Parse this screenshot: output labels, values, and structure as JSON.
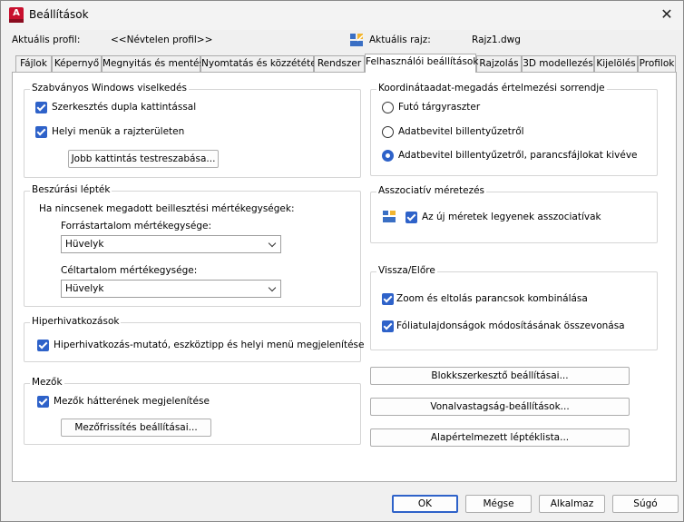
{
  "window": {
    "title": "Beállítások",
    "close_glyph": "✕",
    "app_icon_letter": "A"
  },
  "header": {
    "profile_label": "Aktuális profil:",
    "profile_value": "<<Névtelen profil>>",
    "drawing_label": "Aktuális rajz:",
    "drawing_value": "Rajz1.dwg"
  },
  "tabs": [
    {
      "label": "Fájlok"
    },
    {
      "label": "Képernyő"
    },
    {
      "label": "Megnyitás és mentés"
    },
    {
      "label": "Nyomtatás és közzététel"
    },
    {
      "label": "Rendszer"
    },
    {
      "label": "Felhasználói beállítások"
    },
    {
      "label": "Rajzolás"
    },
    {
      "label": "3D modellezés"
    },
    {
      "label": "Kijelölés"
    },
    {
      "label": "Profilok"
    }
  ],
  "windows_behavior": {
    "title": "Szabványos Windows viselkedés",
    "dblclick_edit": "Szerkesztés dupla kattintással",
    "shortcut_menus": "Helyi menük a rajzterületen",
    "right_click_button": "Jobb kattintás testreszabása..."
  },
  "insertion_scale": {
    "title": "Beszúrási lépték",
    "desc": "Ha nincsenek megadott beillesztési mértékegységek:",
    "source_label": "Forrástartalom mértékegysége:",
    "source_value": "Hüvelyk",
    "target_label": "Céltartalom mértékegysége:",
    "target_value": "Hüvelyk"
  },
  "hyperlink": {
    "title": "Hiperhivatkozások",
    "display": "Hiperhivatkozás-mutató, eszköztipp és helyi menü megjelenítése"
  },
  "fields": {
    "title": "Mezők",
    "background": "Mezők hátterének megjelenítése",
    "update_button": "Mezőfrissítés beállításai..."
  },
  "coord_priority": {
    "title": "Koordinátaadat-megadás értelmezési sorrendje",
    "options": [
      "Futó tárgyraszter",
      "Adatbevitel billentyűzetről",
      "Adatbevitel billentyűzetről, parancsfájlokat kivéve"
    ],
    "selected": "Adatbevitel billentyűzetről, parancsfájlokat kivéve"
  },
  "assoc_dim": {
    "title": "Asszociatív méretezés",
    "make_assoc": "Az új méretek legyenek asszociatívak"
  },
  "undo_redo": {
    "title": "Vissza/Előre",
    "combine_zoom": "Zoom és eltolás parancsok kombinálása",
    "combine_layer": "Fóliatulajdonságok módosításának összevonása"
  },
  "right_buttons": {
    "block_editor": "Blokkszerkesztő beállításai...",
    "lineweight": "Vonalvastagság-beállítások...",
    "scale_list": "Alapértelmezett léptéklista..."
  },
  "footer": {
    "ok": "OK",
    "cancel": "Mégse",
    "apply": "Alkalmaz",
    "help": "Súgó"
  },
  "colors": {
    "accent": "#2e62c9",
    "app_red": "#c8102e"
  },
  "icons": [
    "close-icon",
    "app-logo-icon",
    "drawing-file-icon",
    "assoc-dim-icon",
    "chevron-down-icon",
    "checkbox-checked-icon",
    "radio-icon"
  ]
}
